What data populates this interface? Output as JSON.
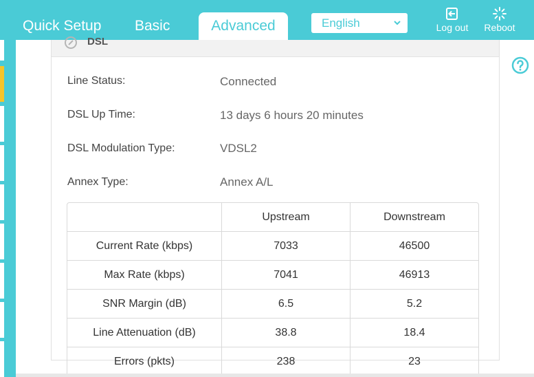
{
  "nav": {
    "tabs": [
      {
        "label": "Quick Setup"
      },
      {
        "label": "Basic"
      },
      {
        "label": "Advanced"
      }
    ],
    "language": "English",
    "logout_label": "Log out",
    "reboot_label": "Reboot"
  },
  "panel": {
    "title": "DSL",
    "fields": [
      {
        "label": "Line Status:",
        "value": "Connected"
      },
      {
        "label": "DSL Up Time:",
        "value": "13 days 6 hours 20 minutes"
      },
      {
        "label": "DSL Modulation Type:",
        "value": "VDSL2"
      },
      {
        "label": "Annex Type:",
        "value": "Annex A/L"
      }
    ]
  },
  "stats": {
    "headers": [
      "",
      "Upstream",
      "Downstream"
    ],
    "rows": [
      {
        "name": "Current Rate (kbps)",
        "up": "7033",
        "down": "46500"
      },
      {
        "name": "Max Rate (kbps)",
        "up": "7041",
        "down": "46913"
      },
      {
        "name": "SNR Margin (dB)",
        "up": "6.5",
        "down": "5.2"
      },
      {
        "name": "Line Attenuation (dB)",
        "up": "38.8",
        "down": "18.4"
      },
      {
        "name": "Errors (pkts)",
        "up": "238",
        "down": "23"
      }
    ]
  },
  "colors": {
    "brand": "#4acbd6",
    "active_indicator": "#f6c42a"
  }
}
